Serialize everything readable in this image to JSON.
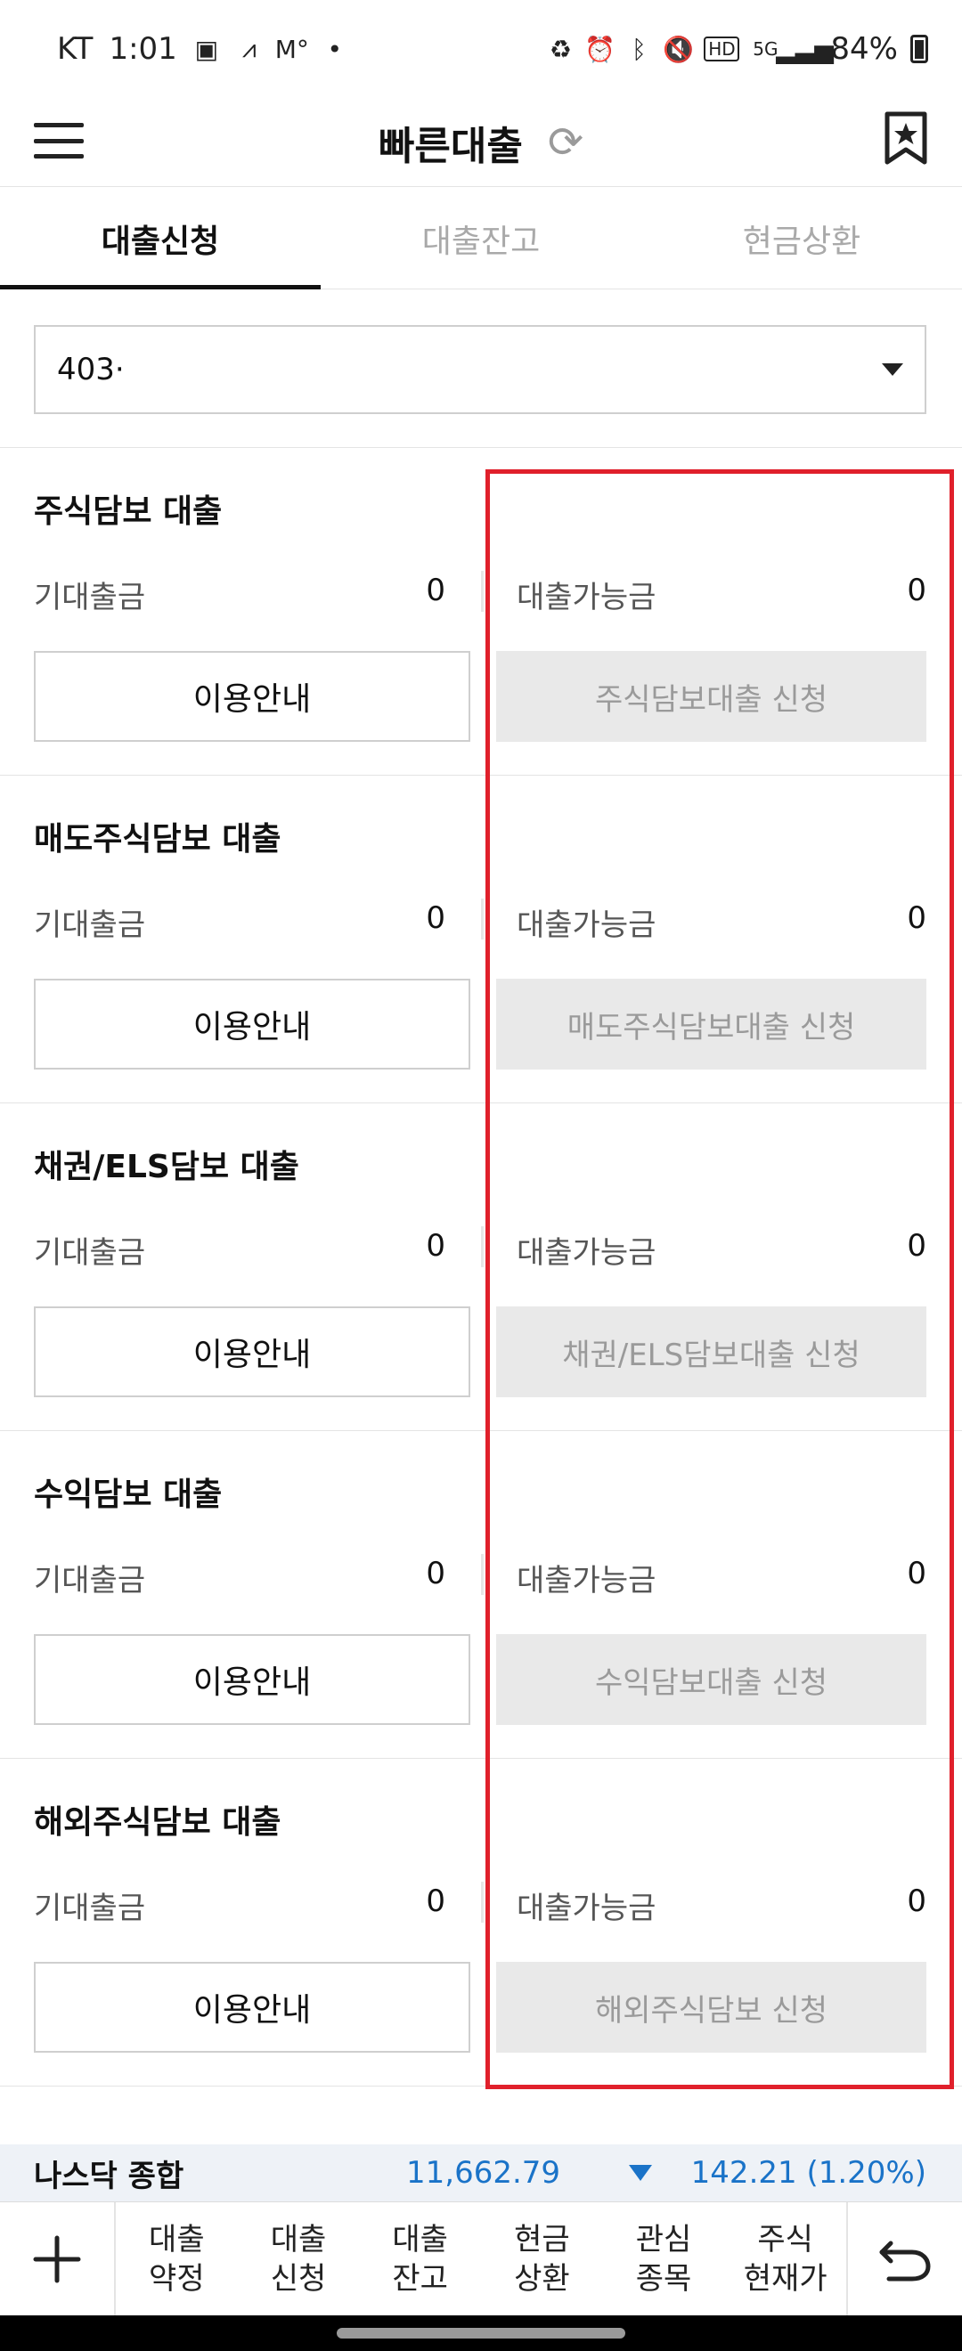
{
  "status_bar": {
    "carrier": "KT",
    "time": "1:01",
    "battery_percent": "84%"
  },
  "header": {
    "title": "빠른대출"
  },
  "tabs": [
    {
      "label": "대출신청",
      "active": true
    },
    {
      "label": "대출잔고",
      "active": false
    },
    {
      "label": "현금상환",
      "active": false
    }
  ],
  "account": {
    "value": "403·"
  },
  "loans": [
    {
      "title": "주식담보 대출",
      "left_label": "기대출금",
      "left_value": "0",
      "right_label": "대출가능금",
      "right_value": "0",
      "guide_label": "이용안내",
      "apply_label": "주식담보대출 신청"
    },
    {
      "title": "매도주식담보 대출",
      "left_label": "기대출금",
      "left_value": "0",
      "right_label": "대출가능금",
      "right_value": "0",
      "guide_label": "이용안내",
      "apply_label": "매도주식담보대출 신청"
    },
    {
      "title": "채권/ELS담보 대출",
      "left_label": "기대출금",
      "left_value": "0",
      "right_label": "대출가능금",
      "right_value": "0",
      "guide_label": "이용안내",
      "apply_label": "채권/ELS담보대출 신청"
    },
    {
      "title": "수익담보 대출",
      "left_label": "기대출금",
      "left_value": "0",
      "right_label": "대출가능금",
      "right_value": "0",
      "guide_label": "이용안내",
      "apply_label": "수익담보대출 신청"
    },
    {
      "title": "해외주식담보 대출",
      "left_label": "기대출금",
      "left_value": "0",
      "right_label": "대출가능금",
      "right_value": "0",
      "guide_label": "이용안내",
      "apply_label": "해외주식담보 신청"
    }
  ],
  "ticker": {
    "name": "나스닥 종합",
    "value": "11,662.79",
    "change": "142.21 (1.20%)",
    "color": "#1a73c8"
  },
  "bottom_nav": {
    "items": [
      "대출\n약정",
      "대출\n신청",
      "대출\n잔고",
      "현금\n상환",
      "관심\n종목",
      "주식\n현재가"
    ]
  },
  "colors": {
    "highlight": "#e0202b",
    "disabled_button": "#e9e9e9"
  }
}
